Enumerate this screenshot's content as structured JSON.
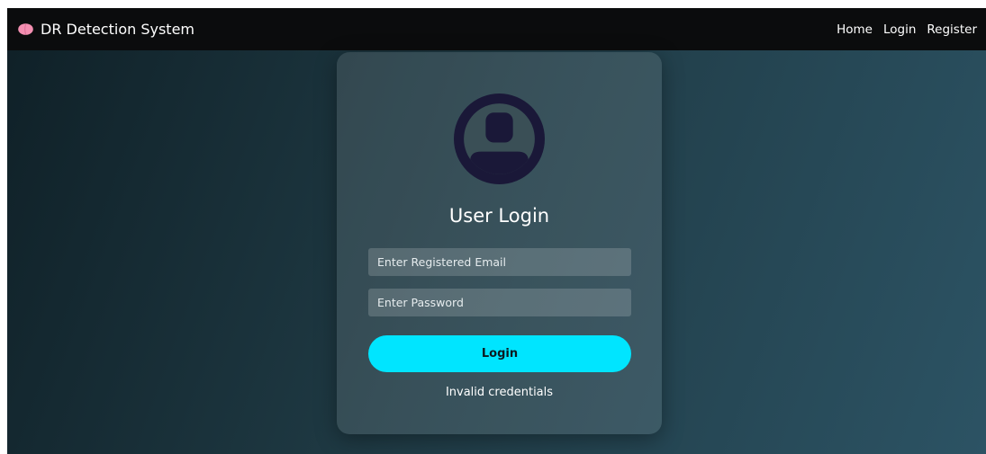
{
  "navbar": {
    "brand_icon": "brain-icon",
    "brand_title": "DR Detection System",
    "links": [
      {
        "label": "Home"
      },
      {
        "label": "Login"
      },
      {
        "label": "Register"
      }
    ]
  },
  "login_card": {
    "avatar_icon": "user-avatar-icon",
    "title": "User Login",
    "email_placeholder": "Enter Registered Email",
    "password_placeholder": "Enter Password",
    "submit_label": "Login",
    "status_message": "Invalid credentials"
  },
  "colors": {
    "navbar_bg": "#0b0c0d",
    "accent": "#00e5ff",
    "avatar": "#1a1838",
    "brand_icon": "#f48fb1"
  }
}
